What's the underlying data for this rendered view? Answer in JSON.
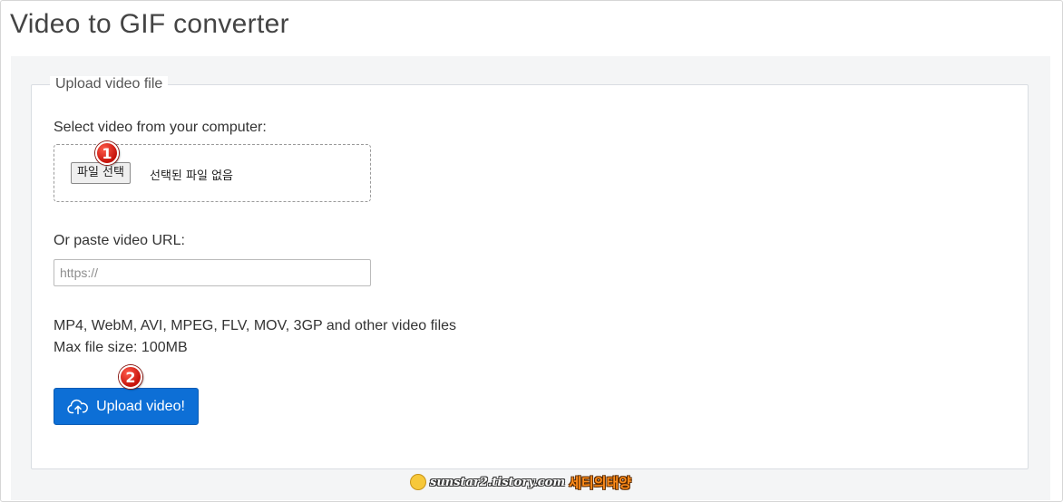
{
  "page": {
    "title": "Video to GIF converter"
  },
  "upload": {
    "legend": "Upload video file",
    "select_label": "Select video from your computer:",
    "file_button": "파일 선택",
    "no_file_text": "선택된 파일 없음",
    "url_label": "Or paste video URL:",
    "url_placeholder": "https://",
    "url_value": "",
    "formats_text": "MP4, WebM, AVI, MPEG, FLV, MOV, 3GP and other video files",
    "max_size_text": "Max file size: 100MB",
    "submit_label": "Upload video!",
    "submit_icon": "cloud-upload-icon"
  },
  "annotations": {
    "badge_1": "1",
    "badge_2": "2"
  },
  "watermark": {
    "url": "sunstar2.tistory.com",
    "name": "세티의태양"
  },
  "colors": {
    "accent": "#0d6fd6",
    "panel_bg": "#f4f5f6",
    "badge": "#d4170d"
  }
}
